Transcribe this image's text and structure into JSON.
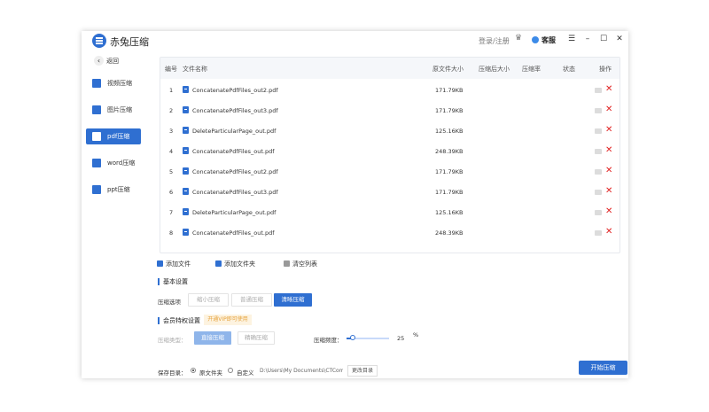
{
  "app": {
    "title": "赤兔压缩"
  },
  "header": {
    "login": "登录/注册",
    "vip": "♛",
    "service": "客服",
    "menu": "☰",
    "minimize": "–",
    "maximize": "☐",
    "close": "✕"
  },
  "sidebar": {
    "back_icon": "‹",
    "back": "返回",
    "items": [
      {
        "label": "视频压缩",
        "icon": "video-icon",
        "color": "#2f6fd1"
      },
      {
        "label": "图片压缩",
        "icon": "image-icon",
        "color": "#2f6fd1"
      },
      {
        "label": "pdf压缩",
        "icon": "pdf-icon",
        "color": "#ffffff",
        "active": true
      },
      {
        "label": "word压缩",
        "icon": "word-icon",
        "color": "#2f6fd1"
      },
      {
        "label": "ppt压缩",
        "icon": "ppt-icon",
        "color": "#2f6fd1"
      }
    ]
  },
  "table": {
    "headers": {
      "index": "编号",
      "name": "文件名称",
      "orig": "原文件大小",
      "comp": "压缩后大小",
      "rate": "压缩率",
      "status": "状态",
      "action": "操作"
    },
    "rows": [
      {
        "index": "1",
        "name": "ConcatenatePdfFiles_out2.pdf",
        "size": "171.79KB",
        "delete": "✕"
      },
      {
        "index": "2",
        "name": "ConcatenatePdfFiles_out3.pdf",
        "size": "171.79KB",
        "delete": "✕"
      },
      {
        "index": "3",
        "name": "DeleteParticularPage_out.pdf",
        "size": "125.16KB",
        "delete": "✕"
      },
      {
        "index": "4",
        "name": "ConcatenatePdfFiles_out.pdf",
        "size": "248.39KB",
        "delete": "✕"
      },
      {
        "index": "5",
        "name": "ConcatenatePdfFiles_out2.pdf",
        "size": "171.79KB",
        "delete": "✕"
      },
      {
        "index": "6",
        "name": "ConcatenatePdfFiles_out3.pdf",
        "size": "171.79KB",
        "delete": "✕"
      },
      {
        "index": "7",
        "name": "DeleteParticularPage_out.pdf",
        "size": "125.16KB",
        "delete": "✕"
      },
      {
        "index": "8",
        "name": "ConcatenatePdfFiles_out.pdf",
        "size": "248.39KB",
        "delete": "✕"
      }
    ]
  },
  "actions": {
    "add_file": "添加文件",
    "add_folder": "添加文件夹",
    "clear": "清空列表"
  },
  "basic": {
    "title": "基本设置",
    "option_label": "压缩选项",
    "options": [
      "缩小压缩",
      "普通压缩",
      "清晰压缩"
    ],
    "selected": "清晰压缩"
  },
  "vip": {
    "title": "会员特权设置",
    "badge": "开通VIP即可使用",
    "type_label": "压缩类型：",
    "types": [
      "直接压缩",
      "精确压缩"
    ],
    "quality_label": "压缩频度：",
    "quality_value": "25",
    "quality_unit": "%",
    "quality_level": 0.15
  },
  "save": {
    "label": "保存目录：",
    "opt1": "原文件夹",
    "opt2": "自定义",
    "path": "D:\\Users\\My Documents\\CTComp",
    "change": "更改目录"
  },
  "start_button": "开始压缩",
  "colors": {
    "accent": "#2f6fd1",
    "danger": "#e02020"
  }
}
